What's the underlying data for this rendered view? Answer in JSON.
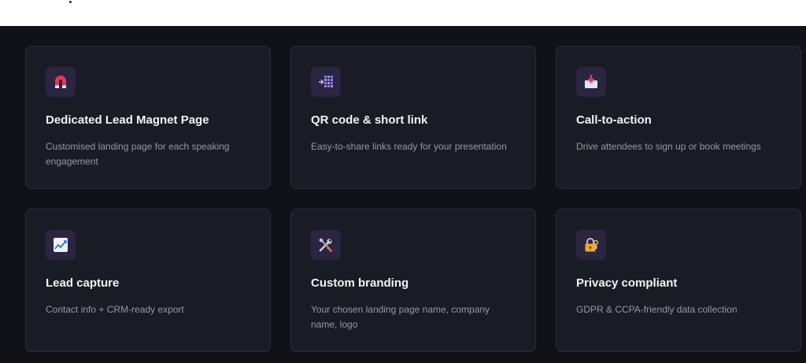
{
  "features": [
    {
      "icon": "magnet-icon",
      "title": "Dedicated Lead Magnet Page",
      "description": "Customised landing page for each speaking engagement"
    },
    {
      "icon": "qr-code-icon",
      "title": "QR code & short link",
      "description": "Easy-to-share links ready for your presentation"
    },
    {
      "icon": "inbox-tray-icon",
      "title": "Call-to-action",
      "description": "Drive attendees to sign up or book meetings"
    },
    {
      "icon": "chart-increasing-icon",
      "title": "Lead capture",
      "description": "Contact info + CRM-ready export"
    },
    {
      "icon": "tools-icon",
      "title": "Custom branding",
      "description": "Your chosen landing page name, company name, logo"
    },
    {
      "icon": "lock-with-key-icon",
      "title": "Privacy compliant",
      "description": "GDPR & CCPA-friendly data collection"
    }
  ],
  "colors": {
    "section_background": "#111218",
    "card_background": "#1a1c25",
    "card_border": "#2a2d38",
    "icon_background": "#2a2540",
    "title_text": "#f1f2f6",
    "description_text": "#9599a6"
  }
}
